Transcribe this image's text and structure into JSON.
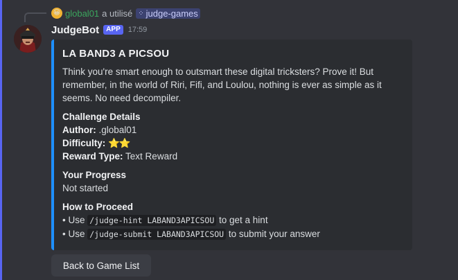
{
  "reply": {
    "user": "global01",
    "action_text": "a utilisé",
    "command": "judge-games"
  },
  "message": {
    "author": "JudgeBot",
    "badge": "APP",
    "timestamp": "17:59"
  },
  "embed": {
    "accent_color": "#1e90ff",
    "title": "LA BAND3 A PICSOU",
    "description": "Think you're smart enough to outsmart these digital tricksters? Prove it! But remember, in the world of Riri, Fifi, and Loulou, nothing is ever as simple as it seems. No need decompiler.",
    "challenge": {
      "heading": "Challenge Details",
      "author_label": "Author:",
      "author_value": ".global01",
      "difficulty_label": "Difficulty:",
      "difficulty_stars": "⭐⭐",
      "reward_label": "Reward Type:",
      "reward_value": "Text Reward"
    },
    "progress": {
      "heading": "Your Progress",
      "value": "Not started"
    },
    "proceed": {
      "heading": "How to Proceed",
      "line1_prefix": "• Use ",
      "line1_code": "/judge-hint LABAND3APICSOU",
      "line1_suffix": " to get a hint",
      "line2_prefix": "• Use ",
      "line2_code": "/judge-submit LABAND3APICSOU",
      "line2_suffix": " to submit your answer"
    }
  },
  "button": {
    "label": "Back to Game List"
  }
}
